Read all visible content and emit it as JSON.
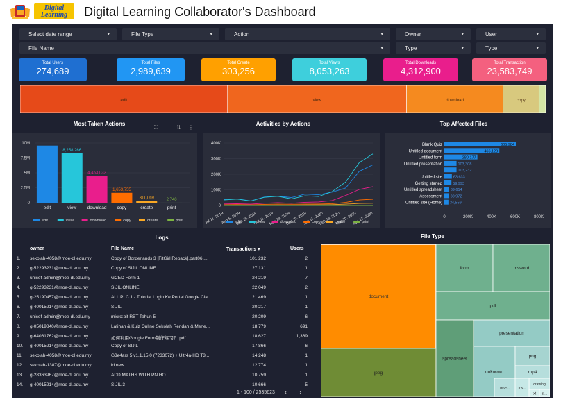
{
  "header": {
    "logo_line1": "Digital",
    "logo_line2": "Learning",
    "title": "Digital Learning Collaborator's Dashboard"
  },
  "filters": {
    "date_range": "Select date range",
    "file_type": "File Type",
    "action": "Action",
    "owner": "Owner",
    "user": "User",
    "file_name": "FIle Name",
    "type1": "Type",
    "type2": "Type"
  },
  "kpis": [
    {
      "label": "Total Users",
      "value": "274,689",
      "color": "#1f6fd1"
    },
    {
      "label": "Total Files",
      "value": "2,989,639",
      "color": "#2196f3"
    },
    {
      "label": "Total Create",
      "value": "303,256",
      "color": "#ffa000"
    },
    {
      "label": "Total Views",
      "value": "8,053,263",
      "color": "#3ecfdc"
    },
    {
      "label": "Total Downloads",
      "value": "4,312,900",
      "color": "#e91e8c"
    },
    {
      "label": "Total Transaction",
      "value": "23,583,749",
      "color": "#f4607f"
    }
  ],
  "stack_bar": [
    {
      "label": "edit",
      "value": 9568000,
      "color": "#e64a19"
    },
    {
      "label": "view",
      "value": 8258266,
      "color": "#f0661e"
    },
    {
      "label": "download",
      "value": 4453033,
      "color": "#f58a1f"
    },
    {
      "label": "copy",
      "value": 1653755,
      "color": "#d8c97e"
    },
    {
      "label": "",
      "value": 311069,
      "color": "#d4e6a5"
    }
  ],
  "panels": {
    "most_taken": "Most Taken Actions",
    "activities": "Activities by Actions",
    "top_files": "Top Affected Files",
    "logs": "Logs",
    "file_type": "File Type"
  },
  "chart_data": [
    {
      "type": "bar",
      "title": "Most Taken Actions",
      "categories": [
        "edit",
        "view",
        "download",
        "copy",
        "create",
        "print"
      ],
      "values": [
        9568000,
        8258266,
        4453033,
        1653755,
        311069,
        2740
      ],
      "data_labels": [
        "",
        "8,258,266",
        "4,453,033",
        "1,653,755",
        "311,069",
        "2,740"
      ],
      "colors": [
        "#1e88e5",
        "#26c6da",
        "#e91e8c",
        "#ff6d00",
        "#f9a825",
        "#7cb342"
      ],
      "yticks": [
        "0",
        "2.5M",
        "5M",
        "7.5M",
        "10M"
      ],
      "ylim": [
        0,
        10000000
      ],
      "legend": [
        "edit",
        "view",
        "download",
        "copy",
        "create",
        "print"
      ]
    },
    {
      "type": "line",
      "title": "Activities by Actions",
      "yticks": [
        "0",
        "100K",
        "200K",
        "300K",
        "400K"
      ],
      "ylim": [
        0,
        400000
      ],
      "xticks": [
        "Jul 11, 2019",
        "Aug 5, 2019",
        "Sep 18, 2019",
        "Oct 11, 2019",
        "Nov 28, 2019",
        "Dec 19, 2019",
        "Jan 11, 2020",
        "Feb 28, 2020",
        "Mar 20, 2020",
        "Apr 12, 2020"
      ],
      "legend": [
        "edit",
        "view",
        "download",
        "copy",
        "create",
        "print"
      ],
      "colors": [
        "#1e88e5",
        "#26c6da",
        "#e91e8c",
        "#ff6d00",
        "#f9a825",
        "#7cb342"
      ],
      "series": [
        {
          "name": "edit",
          "values": [
            40000,
            45000,
            30000,
            55000,
            60000,
            50000,
            70000,
            65000,
            80000,
            120000,
            230000,
            260000
          ]
        },
        {
          "name": "view",
          "values": [
            35000,
            40000,
            28000,
            50000,
            55000,
            45000,
            65000,
            60000,
            90000,
            150000,
            270000,
            330000
          ]
        },
        {
          "name": "download",
          "values": [
            10000,
            12000,
            9000,
            15000,
            18000,
            14000,
            20000,
            22000,
            30000,
            60000,
            110000,
            120000
          ]
        },
        {
          "name": "copy",
          "values": [
            5000,
            6000,
            4000,
            7000,
            8000,
            7000,
            9000,
            10000,
            12000,
            20000,
            35000,
            40000
          ]
        },
        {
          "name": "create",
          "values": [
            2000,
            2000,
            1500,
            3000,
            3000,
            2500,
            3500,
            4000,
            5000,
            8000,
            12000,
            14000
          ]
        },
        {
          "name": "print",
          "values": [
            0,
            0,
            0,
            0,
            0,
            0,
            0,
            0,
            0,
            0,
            0,
            0
          ]
        }
      ]
    },
    {
      "type": "bar",
      "title": "Top Affected Files",
      "orientation": "horizontal",
      "categories": [
        "Blank Quiz",
        "Untitled document",
        "Untitled form",
        "Untitled presentation",
        "",
        "Untitled site",
        "Getting started",
        "Untitled spreadsheet",
        "Assessment",
        "Untitled site (Home)"
      ],
      "values": [
        605984,
        466128,
        280177,
        103308,
        103232,
        63633,
        59993,
        39614,
        38972,
        34559
      ],
      "data_labels": [
        "605,984",
        "466,128",
        "280,177",
        "103,308",
        "103,232",
        "63,633",
        "59,993",
        "39,614",
        "38,972",
        "34,559"
      ],
      "xticks": [
        "0",
        "200K",
        "400K",
        "600K",
        "800K"
      ],
      "xlim": [
        0,
        800000
      ],
      "color": "#1e88e5"
    },
    {
      "type": "heatmap",
      "title": "File Type",
      "categories": [
        "document",
        "form",
        "msword",
        "pdf",
        "jpeg",
        "spreadsheet",
        "presentation",
        "unknown",
        "png",
        "mp4",
        "drawing",
        "mse...",
        "ms...",
        "txt",
        "sl..."
      ]
    }
  ],
  "logs": {
    "headers": [
      "owner",
      "File Name",
      "Transactions ▾",
      "Users"
    ],
    "rows": [
      [
        "1.",
        "sekolah-4058@moe-dl.edu.my",
        "Copy of Borderlands 3 [FitGirl Repack].part06....",
        "101,232",
        "2"
      ],
      [
        "2.",
        "g-52293231@moe-dl.edu.my",
        "Copy of SIJIL ONLINE",
        "27,131",
        "1"
      ],
      [
        "3.",
        "unicef-admin@moe-dl.edu.my",
        "GCED Form 1",
        "24,219",
        "7"
      ],
      [
        "4.",
        "g-52293231@moe-dl.edu.my",
        "SIJIL ONLINE",
        "22,049",
        "2"
      ],
      [
        "5.",
        "g-25190457@moe-dl.edu.my",
        "ALL PLC 1 - Tutorial Login Ke Portal Google Cla...",
        "21,469",
        "1"
      ],
      [
        "6.",
        "g-40015214@moe-dl.edu.my",
        "SIJIL",
        "20,217",
        "1"
      ],
      [
        "7.",
        "unicef-admin@moe-dl.edu.my",
        "micro:bit RBT Tahun 5",
        "20,209",
        "6"
      ],
      [
        "8.",
        "g-05019840@moe-dl.edu.my",
        "Latihan & Kuiz Online Sekolah Rendah & Mene...",
        "18,779",
        "691"
      ],
      [
        "9.",
        "g-64061762@moe-dl.edu.my",
        "如何利用Google Form制作练习？.pdf",
        "18,627",
        "1,369"
      ],
      [
        "10.",
        "g-40015214@moe-dl.edu.my",
        "Copy of SIJIL",
        "17,866",
        "6"
      ],
      [
        "11.",
        "sekolah-4058@moe-dl.edu.my",
        "G3e4ars 5 v1.1.15.0 (7233072) + Ultr4a-HD T3...",
        "14,248",
        "1"
      ],
      [
        "12.",
        "sekolah-1387@moe-dl.edu.my",
        "id new",
        "12,774",
        "1"
      ],
      [
        "13.",
        "g-28363967@moe-dl.edu.my",
        "ADD MATHS WITH PN HO",
        "10,759",
        "1"
      ],
      [
        "14.",
        "g-40015214@moe-dl.edu.my",
        "SIJIL 3",
        "10,666",
        "5"
      ]
    ],
    "pagination": "1 - 100 / 2535623"
  }
}
